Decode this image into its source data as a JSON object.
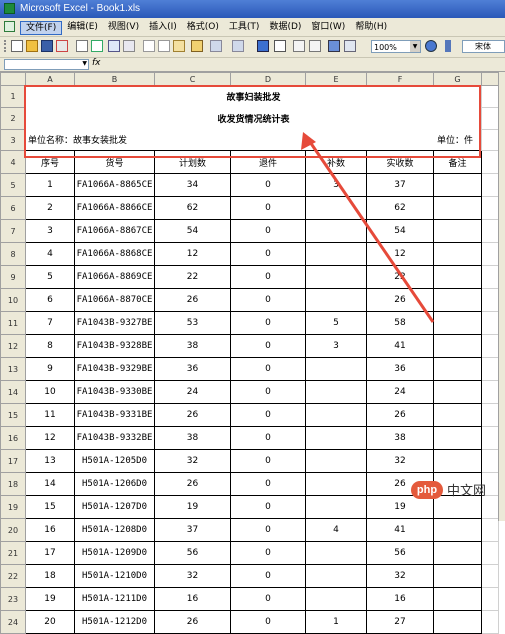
{
  "window": {
    "title": "Microsoft Excel - Book1.xls"
  },
  "menu": {
    "items": [
      "文件(F)",
      "编辑(E)",
      "视图(V)",
      "插入(I)",
      "格式(O)",
      "工具(T)",
      "数据(D)",
      "窗口(W)",
      "帮助(H)"
    ],
    "active_index": 0
  },
  "toolbar": {
    "zoom": "100%",
    "font": "宋体"
  },
  "formula_bar": {
    "fx": "fx"
  },
  "sheet": {
    "columns": [
      "A",
      "B",
      "C",
      "D",
      "E",
      "F",
      "G"
    ],
    "title1": "故事妇装批发",
    "title2": "收发货情况统计表",
    "unit_name": "单位名称：故事女装批发",
    "unit": "单位：件",
    "headers": [
      "序号",
      "货号",
      "计划数",
      "退件",
      "补数",
      "实收数",
      "备注"
    ],
    "rows": [
      [
        "1",
        "FA1066A-8865CE",
        "34",
        "0",
        "3",
        "37",
        ""
      ],
      [
        "2",
        "FA1066A-8866CE",
        "62",
        "0",
        "",
        "62",
        ""
      ],
      [
        "3",
        "FA1066A-8867CE",
        "54",
        "0",
        "",
        "54",
        ""
      ],
      [
        "4",
        "FA1066A-8868CE",
        "12",
        "0",
        "",
        "12",
        ""
      ],
      [
        "5",
        "FA1066A-8869CE",
        "22",
        "0",
        "",
        "22",
        ""
      ],
      [
        "6",
        "FA1066A-8870CE",
        "26",
        "0",
        "",
        "26",
        ""
      ],
      [
        "7",
        "FA1043B-9327BE",
        "53",
        "0",
        "5",
        "58",
        ""
      ],
      [
        "8",
        "FA1043B-9328BE",
        "38",
        "0",
        "3",
        "41",
        ""
      ],
      [
        "9",
        "FA1043B-9329BE",
        "36",
        "0",
        "",
        "36",
        ""
      ],
      [
        "10",
        "FA1043B-9330BE",
        "24",
        "0",
        "",
        "24",
        ""
      ],
      [
        "11",
        "FA1043B-9331BE",
        "26",
        "0",
        "",
        "26",
        ""
      ],
      [
        "12",
        "FA1043B-9332BE",
        "38",
        "0",
        "",
        "38",
        ""
      ],
      [
        "13",
        "H501A-1205D0",
        "32",
        "0",
        "",
        "32",
        ""
      ],
      [
        "14",
        "H501A-1206D0",
        "26",
        "0",
        "",
        "26",
        ""
      ],
      [
        "15",
        "H501A-1207D0",
        "19",
        "0",
        "",
        "19",
        ""
      ],
      [
        "16",
        "H501A-1208D0",
        "37",
        "0",
        "4",
        "41",
        ""
      ],
      [
        "17",
        "H501A-1209D0",
        "56",
        "0",
        "",
        "56",
        ""
      ],
      [
        "18",
        "H501A-1210D0",
        "32",
        "0",
        "",
        "32",
        ""
      ],
      [
        "19",
        "H501A-1211D0",
        "16",
        "0",
        "",
        "16",
        ""
      ],
      [
        "20",
        "H501A-1212D0",
        "26",
        "0",
        "1",
        "27",
        ""
      ]
    ]
  },
  "watermark": {
    "logo": "php",
    "text": "中文网"
  },
  "colors": {
    "annotation": "#e64a3a",
    "titlebar": "#2a58b8"
  }
}
